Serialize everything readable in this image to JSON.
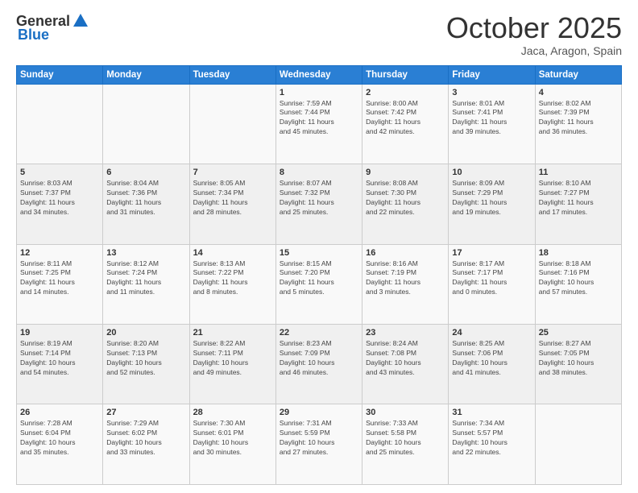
{
  "header": {
    "logo_general": "General",
    "logo_blue": "Blue",
    "month_title": "October 2025",
    "location": "Jaca, Aragon, Spain"
  },
  "days_of_week": [
    "Sunday",
    "Monday",
    "Tuesday",
    "Wednesday",
    "Thursday",
    "Friday",
    "Saturday"
  ],
  "weeks": [
    [
      {
        "day": "",
        "info": ""
      },
      {
        "day": "",
        "info": ""
      },
      {
        "day": "",
        "info": ""
      },
      {
        "day": "1",
        "info": "Sunrise: 7:59 AM\nSunset: 7:44 PM\nDaylight: 11 hours\nand 45 minutes."
      },
      {
        "day": "2",
        "info": "Sunrise: 8:00 AM\nSunset: 7:42 PM\nDaylight: 11 hours\nand 42 minutes."
      },
      {
        "day": "3",
        "info": "Sunrise: 8:01 AM\nSunset: 7:41 PM\nDaylight: 11 hours\nand 39 minutes."
      },
      {
        "day": "4",
        "info": "Sunrise: 8:02 AM\nSunset: 7:39 PM\nDaylight: 11 hours\nand 36 minutes."
      }
    ],
    [
      {
        "day": "5",
        "info": "Sunrise: 8:03 AM\nSunset: 7:37 PM\nDaylight: 11 hours\nand 34 minutes."
      },
      {
        "day": "6",
        "info": "Sunrise: 8:04 AM\nSunset: 7:36 PM\nDaylight: 11 hours\nand 31 minutes."
      },
      {
        "day": "7",
        "info": "Sunrise: 8:05 AM\nSunset: 7:34 PM\nDaylight: 11 hours\nand 28 minutes."
      },
      {
        "day": "8",
        "info": "Sunrise: 8:07 AM\nSunset: 7:32 PM\nDaylight: 11 hours\nand 25 minutes."
      },
      {
        "day": "9",
        "info": "Sunrise: 8:08 AM\nSunset: 7:30 PM\nDaylight: 11 hours\nand 22 minutes."
      },
      {
        "day": "10",
        "info": "Sunrise: 8:09 AM\nSunset: 7:29 PM\nDaylight: 11 hours\nand 19 minutes."
      },
      {
        "day": "11",
        "info": "Sunrise: 8:10 AM\nSunset: 7:27 PM\nDaylight: 11 hours\nand 17 minutes."
      }
    ],
    [
      {
        "day": "12",
        "info": "Sunrise: 8:11 AM\nSunset: 7:25 PM\nDaylight: 11 hours\nand 14 minutes."
      },
      {
        "day": "13",
        "info": "Sunrise: 8:12 AM\nSunset: 7:24 PM\nDaylight: 11 hours\nand 11 minutes."
      },
      {
        "day": "14",
        "info": "Sunrise: 8:13 AM\nSunset: 7:22 PM\nDaylight: 11 hours\nand 8 minutes."
      },
      {
        "day": "15",
        "info": "Sunrise: 8:15 AM\nSunset: 7:20 PM\nDaylight: 11 hours\nand 5 minutes."
      },
      {
        "day": "16",
        "info": "Sunrise: 8:16 AM\nSunset: 7:19 PM\nDaylight: 11 hours\nand 3 minutes."
      },
      {
        "day": "17",
        "info": "Sunrise: 8:17 AM\nSunset: 7:17 PM\nDaylight: 11 hours\nand 0 minutes."
      },
      {
        "day": "18",
        "info": "Sunrise: 8:18 AM\nSunset: 7:16 PM\nDaylight: 10 hours\nand 57 minutes."
      }
    ],
    [
      {
        "day": "19",
        "info": "Sunrise: 8:19 AM\nSunset: 7:14 PM\nDaylight: 10 hours\nand 54 minutes."
      },
      {
        "day": "20",
        "info": "Sunrise: 8:20 AM\nSunset: 7:13 PM\nDaylight: 10 hours\nand 52 minutes."
      },
      {
        "day": "21",
        "info": "Sunrise: 8:22 AM\nSunset: 7:11 PM\nDaylight: 10 hours\nand 49 minutes."
      },
      {
        "day": "22",
        "info": "Sunrise: 8:23 AM\nSunset: 7:09 PM\nDaylight: 10 hours\nand 46 minutes."
      },
      {
        "day": "23",
        "info": "Sunrise: 8:24 AM\nSunset: 7:08 PM\nDaylight: 10 hours\nand 43 minutes."
      },
      {
        "day": "24",
        "info": "Sunrise: 8:25 AM\nSunset: 7:06 PM\nDaylight: 10 hours\nand 41 minutes."
      },
      {
        "day": "25",
        "info": "Sunrise: 8:27 AM\nSunset: 7:05 PM\nDaylight: 10 hours\nand 38 minutes."
      }
    ],
    [
      {
        "day": "26",
        "info": "Sunrise: 7:28 AM\nSunset: 6:04 PM\nDaylight: 10 hours\nand 35 minutes."
      },
      {
        "day": "27",
        "info": "Sunrise: 7:29 AM\nSunset: 6:02 PM\nDaylight: 10 hours\nand 33 minutes."
      },
      {
        "day": "28",
        "info": "Sunrise: 7:30 AM\nSunset: 6:01 PM\nDaylight: 10 hours\nand 30 minutes."
      },
      {
        "day": "29",
        "info": "Sunrise: 7:31 AM\nSunset: 5:59 PM\nDaylight: 10 hours\nand 27 minutes."
      },
      {
        "day": "30",
        "info": "Sunrise: 7:33 AM\nSunset: 5:58 PM\nDaylight: 10 hours\nand 25 minutes."
      },
      {
        "day": "31",
        "info": "Sunrise: 7:34 AM\nSunset: 5:57 PM\nDaylight: 10 hours\nand 22 minutes."
      },
      {
        "day": "",
        "info": ""
      }
    ]
  ]
}
